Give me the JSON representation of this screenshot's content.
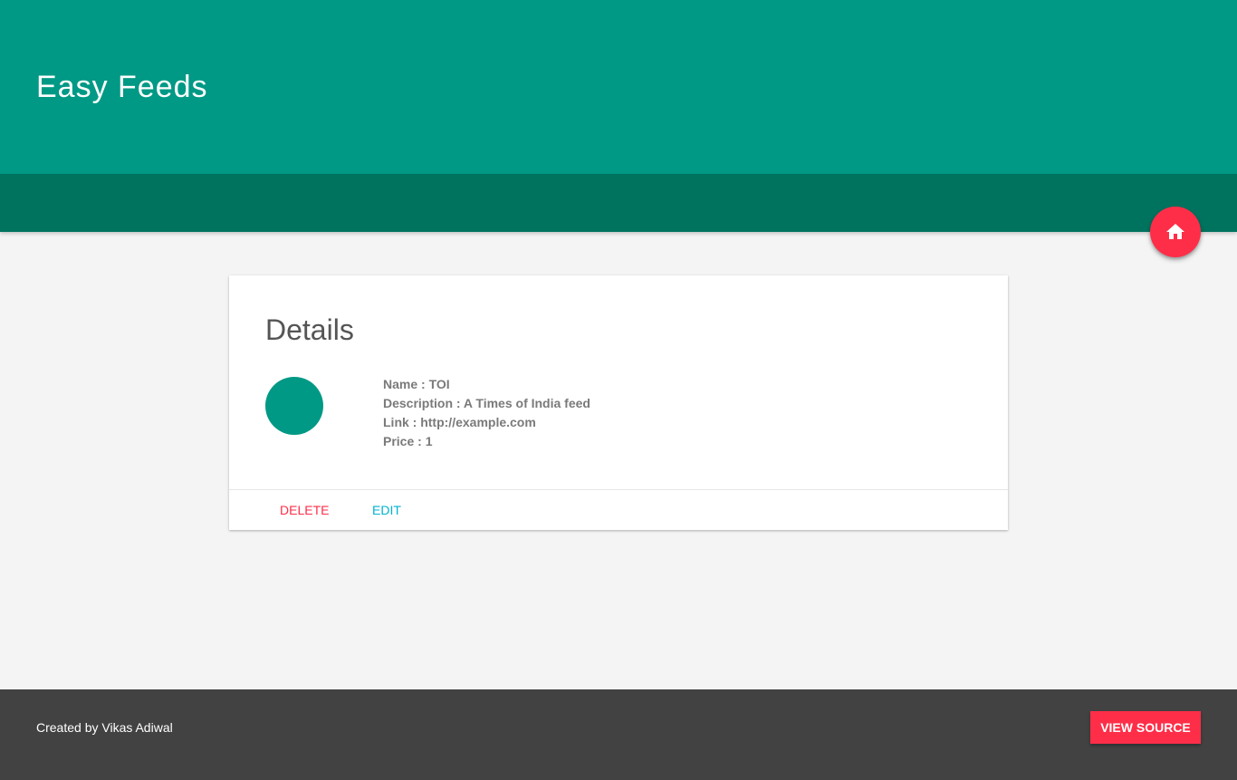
{
  "header": {
    "title": "Easy Feeds"
  },
  "fab": {
    "icon": "home-icon"
  },
  "card": {
    "title": "Details",
    "details": [
      "Name : TOI",
      "Description : A Times of India feed",
      "Link : http://example.com",
      "Price : 1"
    ],
    "actions": {
      "delete_label": "DELETE",
      "edit_label": "EDIT"
    }
  },
  "footer": {
    "credit": "Created by Vikas Adiwal",
    "button_label": "VIEW SOURCE"
  },
  "colors": {
    "primary": "#009985",
    "primary_dark": "#00735f",
    "accent": "#ff2e48",
    "edit": "#00b3d1",
    "footer_bg": "#424242",
    "page_bg": "#f4f4f4"
  }
}
